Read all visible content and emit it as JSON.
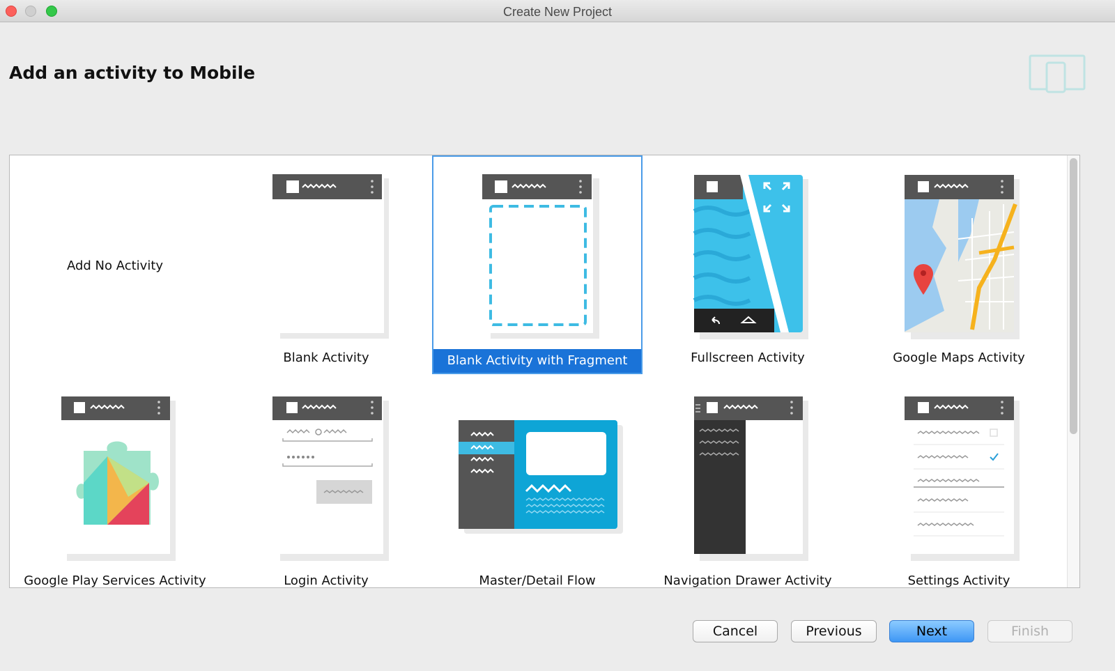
{
  "window": {
    "title": "Create New Project"
  },
  "heading": "Add an activity to Mobile",
  "activities": [
    {
      "label": "Add No Activity",
      "kind": "none"
    },
    {
      "label": "Blank Activity",
      "kind": "blank"
    },
    {
      "label": "Blank Activity with Fragment",
      "kind": "fragment",
      "selected": true
    },
    {
      "label": "Fullscreen Activity",
      "kind": "fullscreen"
    },
    {
      "label": "Google Maps Activity",
      "kind": "maps"
    },
    {
      "label": "Google Play Services Activity",
      "kind": "playservices"
    },
    {
      "label": "Login Activity",
      "kind": "login"
    },
    {
      "label": "Master/Detail Flow",
      "kind": "masterdetail"
    },
    {
      "label": "Navigation Drawer Activity",
      "kind": "navdrawer"
    },
    {
      "label": "Settings Activity",
      "kind": "settings"
    }
  ],
  "buttons": {
    "cancel": "Cancel",
    "previous": "Previous",
    "next": "Next",
    "finish": "Finish"
  },
  "colors": {
    "accent": "#1a73d8",
    "selection_border": "#4a9be8",
    "actionbar": "#555555",
    "fragment_dash": "#3ebbe3",
    "teal": "#0ea5d6"
  }
}
